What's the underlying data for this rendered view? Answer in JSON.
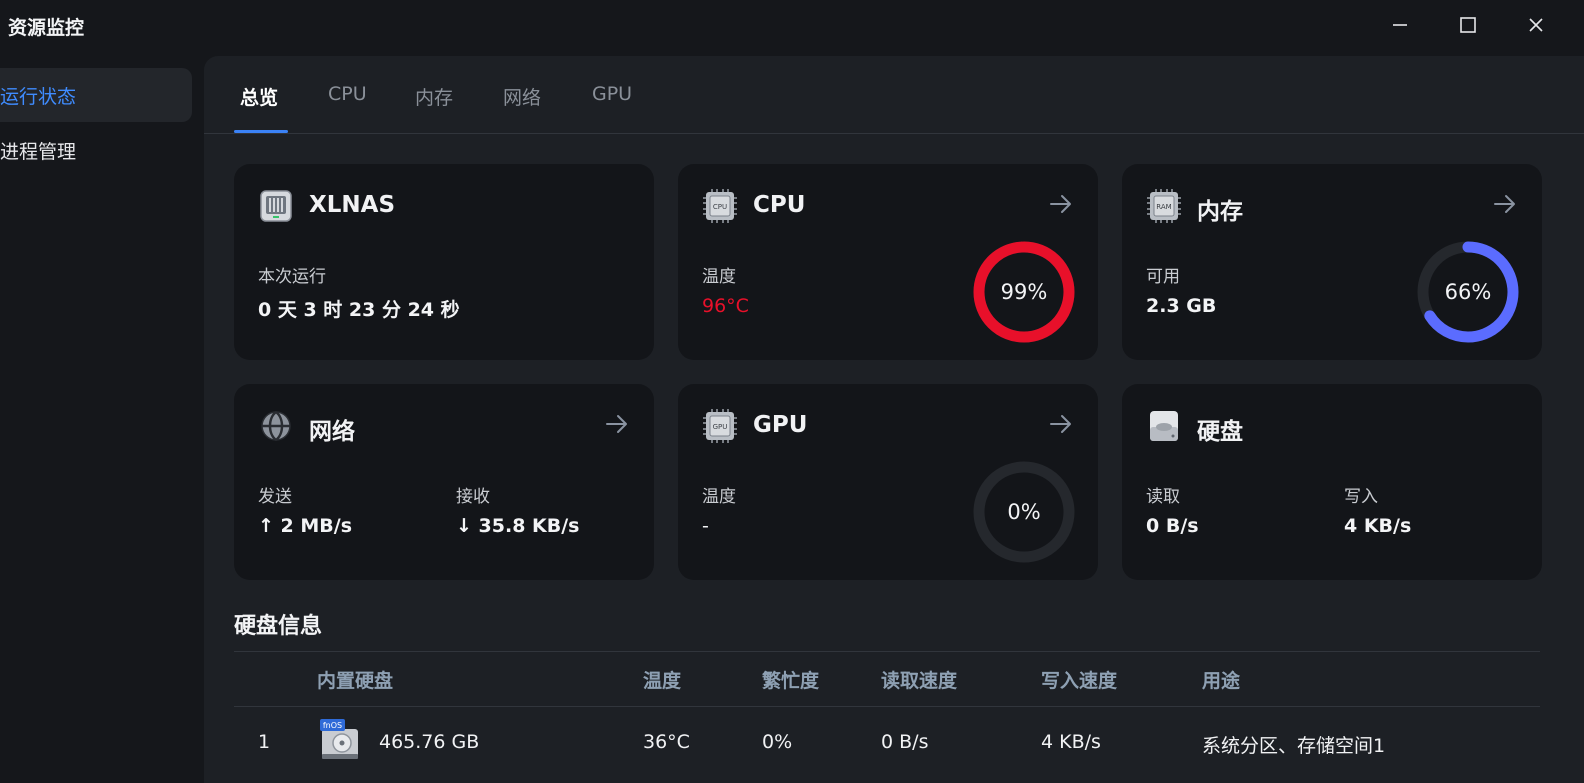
{
  "app": {
    "title": "资源监控"
  },
  "sidebar": {
    "items": [
      {
        "label": "运行状态",
        "active": true
      },
      {
        "label": "进程管理",
        "active": false
      }
    ]
  },
  "tabs": [
    {
      "label": "总览",
      "active": true
    },
    {
      "label": "CPU"
    },
    {
      "label": "内存"
    },
    {
      "label": "网络"
    },
    {
      "label": "GPU"
    }
  ],
  "cards": {
    "system": {
      "title": "XLNAS",
      "label": "本次运行",
      "value": "0 天 3 时 23 分 24 秒",
      "icon": "nas-icon"
    },
    "cpu": {
      "title": "CPU",
      "label": "温度",
      "value": "96°C",
      "percent_text": "99%",
      "percent": 99,
      "ring_color": "#e8102a",
      "icon": "cpu-chip-icon",
      "icon_text": "CPU"
    },
    "memory": {
      "title": "内存",
      "label": "可用",
      "value": "2.3 GB",
      "percent_text": "66%",
      "percent": 66,
      "ring_color": "#5b6cff",
      "icon": "ram-chip-icon",
      "icon_text": "RAM"
    },
    "network": {
      "title": "网络",
      "send_label": "发送",
      "send_value": "↑ 2 MB/s",
      "recv_label": "接收",
      "recv_value": "↓ 35.8 KB/s",
      "icon": "network-globe-icon"
    },
    "gpu": {
      "title": "GPU",
      "label": "温度",
      "value": "-",
      "percent_text": "0%",
      "percent": 0,
      "icon": "gpu-chip-icon",
      "icon_text": "GPU"
    },
    "disk": {
      "title": "硬盘",
      "read_label": "读取",
      "read_value": "0 B/s",
      "write_label": "写入",
      "write_value": "4 KB/s",
      "icon": "hard-disk-icon"
    }
  },
  "disk_info": {
    "title": "硬盘信息",
    "columns": [
      "内置硬盘",
      "温度",
      "繁忙度",
      "读取速度",
      "写入速度",
      "用途"
    ],
    "rows": [
      {
        "index": "1",
        "badge": "fnOS",
        "size": "465.76 GB",
        "temp": "36°C",
        "busy": "0%",
        "read": "0 B/s",
        "write": "4 KB/s",
        "usage": "系统分区、存储空间1"
      }
    ]
  }
}
